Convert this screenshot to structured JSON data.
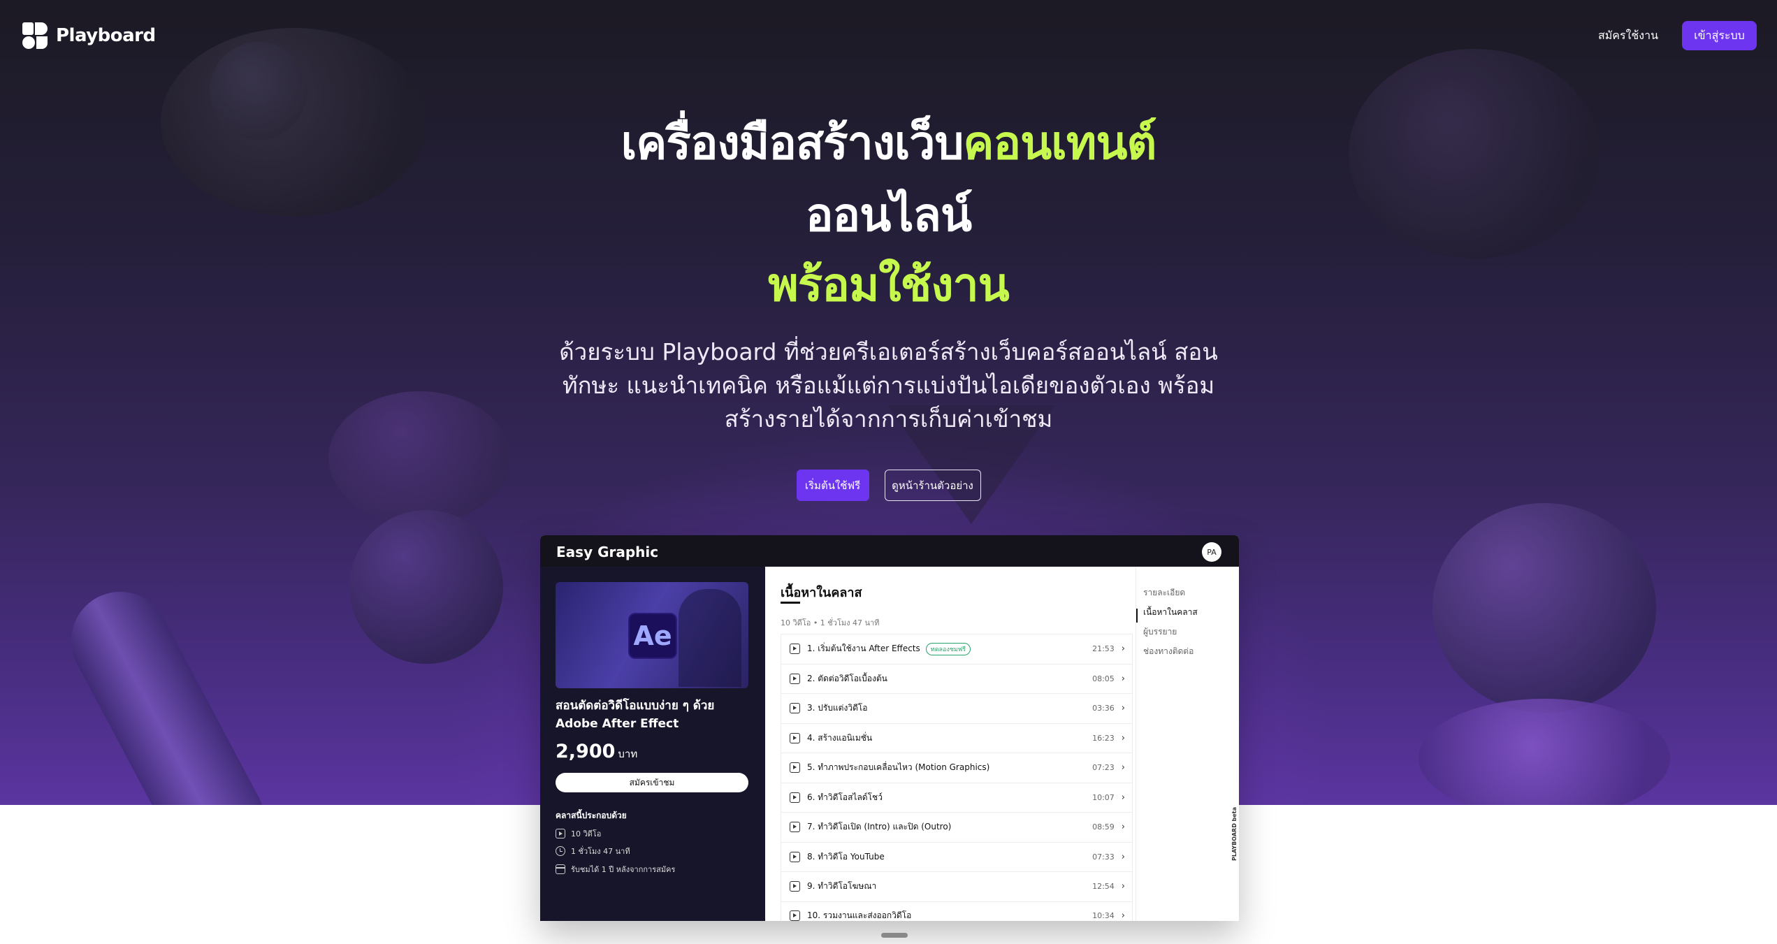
{
  "header": {
    "logo_text": "Playboard",
    "signup_label": "สมัครใช้งาน",
    "login_label": "เข้าสู่ระบบ"
  },
  "hero": {
    "line1_white": "เครื่องมือสร้างเว็บ",
    "line1_accent": "คอนเทนต์",
    "line2": "ออนไลน์",
    "line3": "พร้อมใช้งาน",
    "subtitle": "ด้วยระบบ Playboard ที่ช่วยครีเอเตอร์สร้างเว็บคอร์สออนไลน์ สอนทักษะ แนะนำเทคนิค หรือแม้แต่การแบ่งปันไอเดียของตัวเอง พร้อมสร้างรายได้จากการเก็บค่าเข้าชม",
    "cta_primary": "เริ่มต้นใช้ฟรี",
    "cta_secondary": "ดูหน้าร้านตัวอย่าง",
    "accent_color": "#c6f84d",
    "brand_color": "#6d35f0"
  },
  "preview": {
    "site_title": "Easy Graphic",
    "avatar": "PA",
    "thumb_badge": "Ae",
    "course_title": "สอนตัดต่อวิดีโอแบบง่าย ๆ ด้วย Adobe After Effect",
    "price": "2,900",
    "price_unit": "บาท",
    "enroll_label": "สมัครเข้าชม",
    "includes_title": "คลาสนี้ประกอบด้วย",
    "includes": [
      {
        "icon": "play-icon",
        "text": "10 วิดีโอ"
      },
      {
        "icon": "clock-icon",
        "text": "1 ชั่วโมง 47 นาที"
      },
      {
        "icon": "calendar-icon",
        "text": "รับชมได้ 1 ปี หลังจากการสมัคร"
      }
    ],
    "section_title": "เนื้อหาในคลาส",
    "section_meta": "10 วิดีโอ • 1 ชั่วโมง 47 นาที",
    "lessons": [
      {
        "title": "1. เริ่มต้นใช้งาน After Effects",
        "badge": "ทดลองชมฟรี",
        "duration": "21:53"
      },
      {
        "title": "2. ตัดต่อวิดีโอเบื้องต้น",
        "badge": "",
        "duration": "08:05"
      },
      {
        "title": "3. ปรับแต่งวิดีโอ",
        "badge": "",
        "duration": "03:36"
      },
      {
        "title": "4. สร้างแอนิเมชั่น",
        "badge": "",
        "duration": "16:23"
      },
      {
        "title": "5. ทำภาพประกอบเคลื่อนไหว (Motion Graphics)",
        "badge": "",
        "duration": "07:23"
      },
      {
        "title": "6. ทำวิดีโอสไลด์โชว์",
        "badge": "",
        "duration": "10:07"
      },
      {
        "title": "7. ทำวิดีโอเปิด (Intro) และปิด (Outro)",
        "badge": "",
        "duration": "08:59"
      },
      {
        "title": "8. ทำวิดีโอ YouTube",
        "badge": "",
        "duration": "07:33"
      },
      {
        "title": "9. ทำวิดีโอโฆษณา",
        "badge": "",
        "duration": "12:54"
      },
      {
        "title": "10. รวมงานและส่งออกวิดีโอ",
        "badge": "",
        "duration": "10:34"
      }
    ],
    "side_nav": [
      "รายละเอียด",
      "เนื้อหาในคลาส",
      "ผู้บรรยาย",
      "ช่องทางติดต่อ"
    ],
    "side_brand": "PLAYBOARD beta"
  }
}
